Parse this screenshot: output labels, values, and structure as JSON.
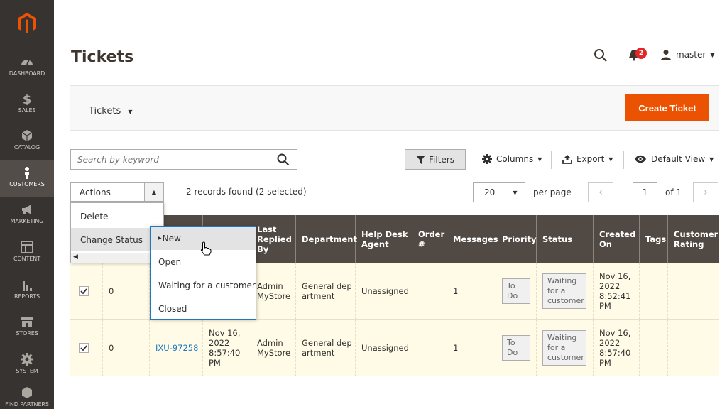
{
  "sidebar": {
    "items": [
      {
        "label": "DASHBOARD",
        "icon": "gauge-icon"
      },
      {
        "label": "SALES",
        "icon": "dollar-icon"
      },
      {
        "label": "CATALOG",
        "icon": "cube-icon"
      },
      {
        "label": "CUSTOMERS",
        "icon": "person-icon"
      },
      {
        "label": "MARKETING",
        "icon": "megaphone-icon"
      },
      {
        "label": "CONTENT",
        "icon": "layout-icon"
      },
      {
        "label": "REPORTS",
        "icon": "bar-chart-icon"
      },
      {
        "label": "STORES",
        "icon": "store-icon"
      },
      {
        "label": "SYSTEM",
        "icon": "gear-icon"
      },
      {
        "label": "FIND PARTNERS",
        "icon": "box-icon"
      }
    ]
  },
  "header": {
    "title": "Tickets",
    "notifications_count": "2",
    "user": "master"
  },
  "page_actions": {
    "switcher_label": "Tickets",
    "create_label": "Create Ticket"
  },
  "toolbar": {
    "search_placeholder": "Search by keyword",
    "filters_label": "Filters",
    "columns_label": "Columns",
    "export_label": "Export",
    "view_label": "Default View",
    "actions_label": "Actions",
    "records_text": "2 records found (2 selected)",
    "per_page_value": "20",
    "per_page_label": "per page",
    "page_value": "1",
    "page_of": "of 1"
  },
  "actions_menu": {
    "items": [
      "Delete",
      "Change Status"
    ],
    "submenu": [
      "New",
      "Open",
      "Waiting for a customer",
      "Closed"
    ]
  },
  "table": {
    "columns": {
      "last_replied": "Last Replied By",
      "department": "Department",
      "agent": "Help Desk Agent",
      "order": "Order #",
      "messages": "Messages",
      "priority": "Priority",
      "status": "Status",
      "created": "Created On",
      "tags": "Tags",
      "rating": "Customer Rating"
    },
    "rows": [
      {
        "id_col": "0",
        "code": "",
        "last_reply": "",
        "replied_by": "Admin MyStore",
        "department": "General dep artment",
        "agent": "Unassigned",
        "order": "",
        "messages": "1",
        "priority": "To Do",
        "status": "Waiting for a customer",
        "created": "Nov 16, 2022 8:52:41 PM"
      },
      {
        "id_col": "0",
        "code": "IXU-97258",
        "last_reply": "Nov 16, 2022 8:57:40 PM",
        "replied_by": "Admin MyStore",
        "department": "General dep artment",
        "agent": "Unassigned",
        "order": "",
        "messages": "1",
        "priority": "To Do",
        "status": "Waiting for a customer",
        "created": "Nov 16, 2022 8:57:40 PM"
      }
    ]
  },
  "colors": {
    "sidebar_bg": "#373330",
    "accent": "#eb5202",
    "table_header": "#514943",
    "row_selected": "#fffbe6",
    "link": "#1979c3"
  }
}
